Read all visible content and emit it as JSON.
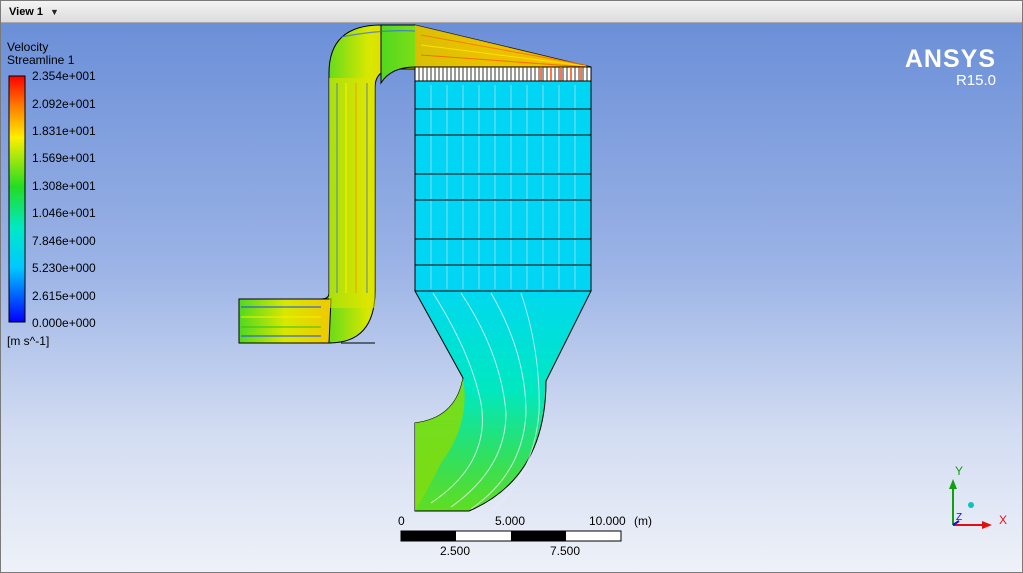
{
  "view": {
    "title": "View 1"
  },
  "legend": {
    "variable": "Velocity",
    "name": "Streamline 1",
    "unit": "[m s^-1]",
    "ticks": [
      "2.354e+001",
      "2.092e+001",
      "1.831e+001",
      "1.569e+001",
      "1.308e+001",
      "1.046e+001",
      "7.846e+000",
      "5.230e+000",
      "2.615e+000",
      "0.000e+000"
    ]
  },
  "logo": {
    "brand": "ANSYS",
    "version": "R15.0"
  },
  "scale": {
    "top_labels": [
      "0",
      "5.000",
      "10.000"
    ],
    "unit": "(m)",
    "bottom_labels": [
      "2.500",
      "7.500"
    ]
  },
  "axes": {
    "y": "Y",
    "z": "Z",
    "x": "X"
  },
  "colors": {
    "axis_x": "#e01010",
    "axis_y": "#10a010",
    "axis_z": "#1010e0",
    "triad_dot": "#10c0c0"
  }
}
